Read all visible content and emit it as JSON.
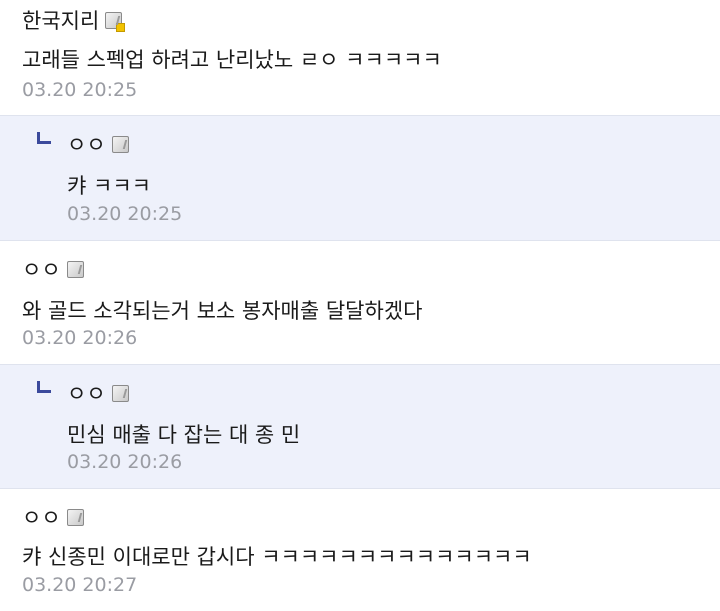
{
  "comments": [
    {
      "nick": "한국지리",
      "badge": "gold-badge-icon",
      "text": "고래들 스펙업 하려고 난리났노 ㄹㅇ ㅋㅋㅋㅋㅋ",
      "time": "03.20 20:25",
      "reply": false
    },
    {
      "nick": "ㅇㅇ",
      "badge": "badge-icon",
      "text": "캬 ㅋㅋㅋ",
      "time": "03.20 20:25",
      "reply": true
    },
    {
      "nick": "ㅇㅇ",
      "badge": "badge-icon",
      "text": "와 골드 소각되는거 보소 봉자매출 달달하겠다",
      "time": "03.20 20:26",
      "reply": false
    },
    {
      "nick": "ㅇㅇ",
      "badge": "badge-icon",
      "text": "민심 매출 다 잡는 대 종 민",
      "time": "03.20 20:26",
      "reply": true
    },
    {
      "nick": "ㅇㅇ",
      "badge": "badge-icon",
      "text": "캬 신종민 이대로만 갑시다 ㅋㅋㅋㅋㅋㅋㅋㅋㅋㅋㅋㅋㅋㅋ",
      "time": "03.20 20:27",
      "reply": false
    }
  ],
  "colors": {
    "reply_background": "#eef1fb",
    "reply_arrow": "#3b4a9c",
    "timestamp": "#9a9ca3",
    "divider": "#dfe3ee"
  }
}
